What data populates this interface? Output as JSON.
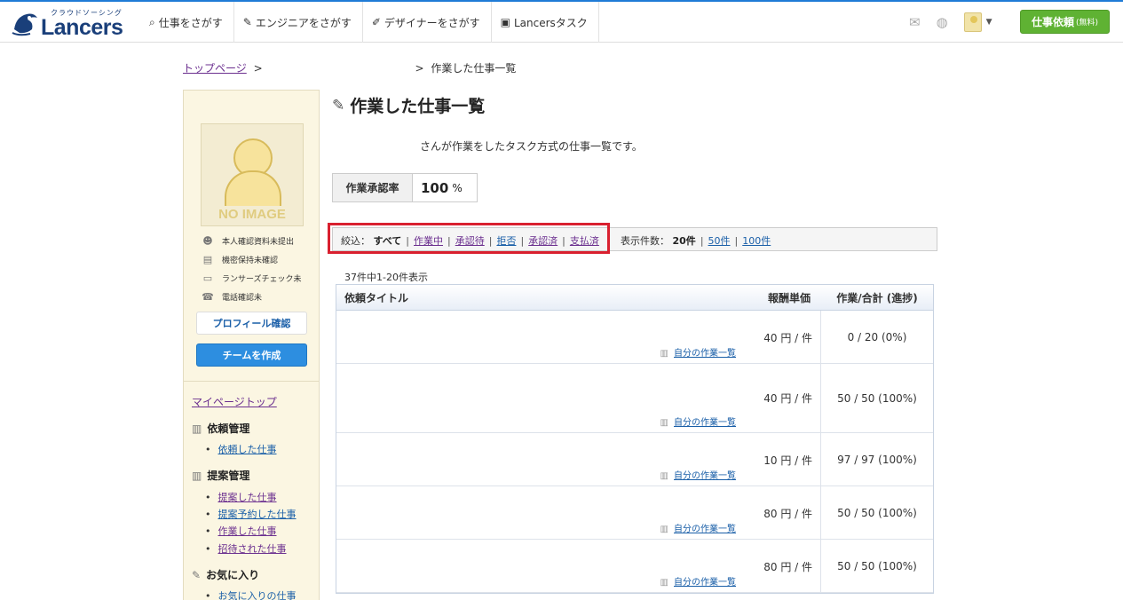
{
  "header": {
    "logo_tag": "クラウドソーシング",
    "logo_word": "Lancers",
    "nav": [
      {
        "icon": "⌕",
        "label": "仕事をさがす"
      },
      {
        "icon": "✎",
        "label": "エンジニアをさがす"
      },
      {
        "icon": "✐",
        "label": "デザイナーをさがす"
      },
      {
        "icon": "▣",
        "label": "Lancersタスク"
      }
    ],
    "request_label": "仕事依頼",
    "request_sub": "(無料)",
    "colors": {
      "accent": "#1f7bd6",
      "request": "#5fb233"
    }
  },
  "breadcrumb": {
    "top": "トップページ",
    "sep1": ">",
    "sep2": ">",
    "current": "作業した仕事一覧"
  },
  "sidebar": {
    "noimage_label": "NO IMAGE",
    "verifications": [
      {
        "icon": "☻",
        "label": "本人確認資料未提出"
      },
      {
        "icon": "▤",
        "label": "機密保持未確認"
      },
      {
        "icon": "▭",
        "label": "ランサーズチェック未"
      },
      {
        "icon": "☎",
        "label": "電話確認未"
      }
    ],
    "profile_button": "プロフィール確認",
    "team_button": "チームを作成",
    "mypage_top": "マイページトップ",
    "sections": [
      {
        "title": "依頼管理",
        "icon": "▥",
        "items": [
          "依頼した仕事"
        ]
      },
      {
        "title": "提案管理",
        "icon": "▥",
        "items": [
          "提案した仕事",
          "提案予約した仕事",
          "作業した仕事",
          "招待された仕事"
        ]
      },
      {
        "title": "お気に入り",
        "icon": "✎",
        "items": [
          "お気に入りの仕事"
        ]
      }
    ]
  },
  "main": {
    "title": "作業した仕事一覧",
    "description": "さんが作業をしたタスク方式の仕事一覧です。",
    "approval_label": "作業承認率",
    "approval_value": "100",
    "approval_unit": "%",
    "filter_label": "絞込：",
    "filters": [
      "すべて",
      "作業中",
      "承認待",
      "拒否",
      "承認済",
      "支払済"
    ],
    "perpage_label": "表示件数：",
    "perpage_options": [
      "20件",
      "50件",
      "100件"
    ],
    "count_text": "37件中1-20件表示",
    "table": {
      "headers": [
        "依頼タイトル",
        "報酬単価",
        "作業/合計 (進捗)"
      ],
      "my_work_label": "自分の作業一覧",
      "rows": [
        {
          "price": "40 円 / 件",
          "progress": "0 / 20 (0%)"
        },
        {
          "price": "40 円 / 件",
          "progress": "50 / 50 (100%)"
        },
        {
          "price": "10 円 / 件",
          "progress": "97 / 97 (100%)"
        },
        {
          "price": "80 円 / 件",
          "progress": "50 / 50 (100%)"
        },
        {
          "price": "80 円 / 件",
          "progress": "50 / 50 (100%)"
        }
      ]
    }
  }
}
